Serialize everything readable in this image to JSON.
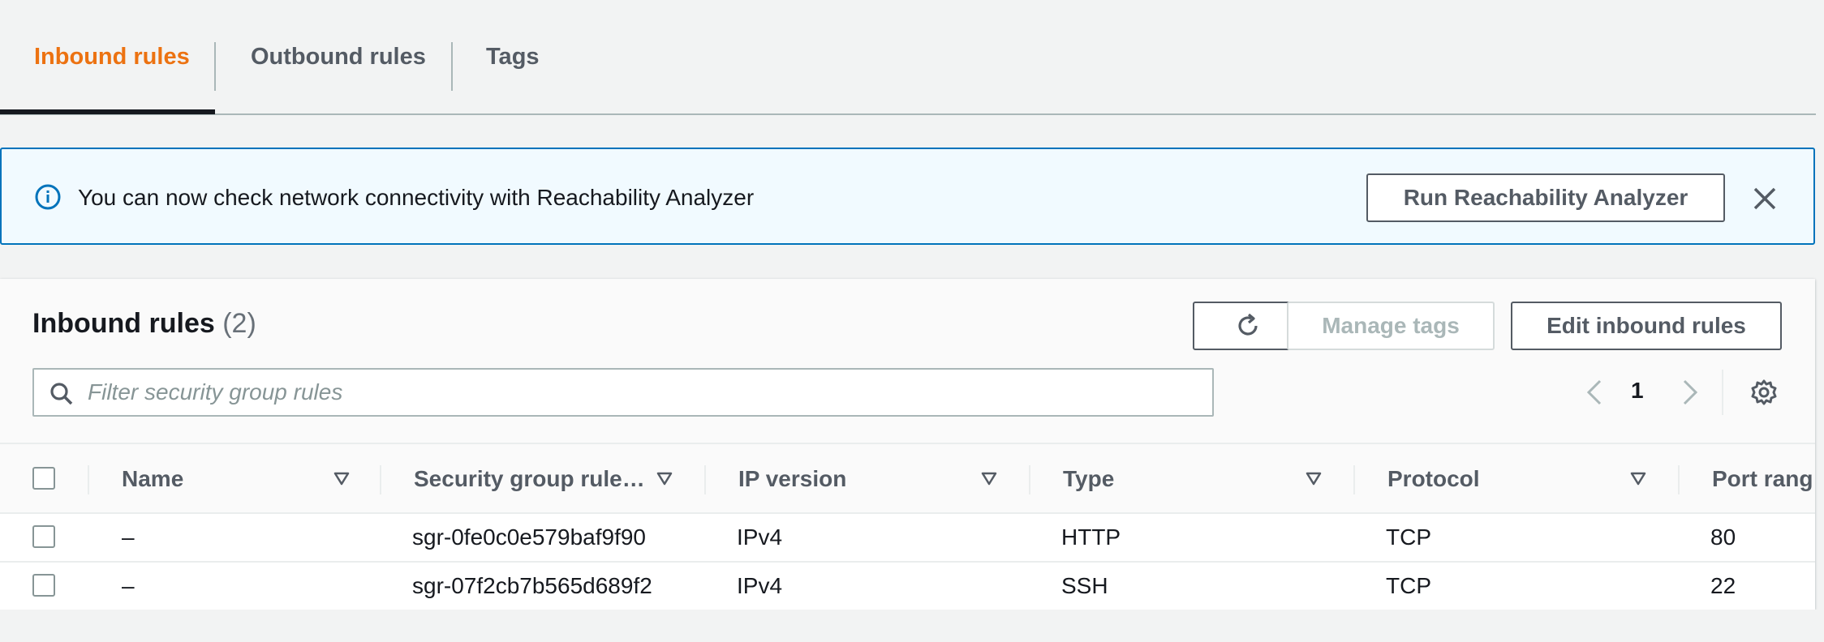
{
  "tabs": [
    {
      "label": "Inbound rules",
      "active": true
    },
    {
      "label": "Outbound rules",
      "active": false
    },
    {
      "label": "Tags",
      "active": false
    }
  ],
  "flash": {
    "text": "You can now check network connectivity with Reachability Analyzer",
    "button_label": "Run Reachability Analyzer",
    "icon": "info-icon",
    "close_icon": "close-icon"
  },
  "panel": {
    "title": "Inbound rules",
    "count": "(2)",
    "manage_tags_label": "Manage tags",
    "edit_label": "Edit inbound rules",
    "refresh_icon": "refresh-icon"
  },
  "search": {
    "placeholder": "Filter security group rules"
  },
  "pagination": {
    "current_page": "1"
  },
  "table": {
    "columns": [
      "Name",
      "Security group rule…",
      "IP version",
      "Type",
      "Protocol",
      "Port rang"
    ],
    "rows": [
      {
        "name": "–",
        "rule_id": "sgr-0fe0c0e579baf9f90",
        "ip_version": "IPv4",
        "type": "HTTP",
        "protocol": "TCP",
        "port": "80"
      },
      {
        "name": "–",
        "rule_id": "sgr-07f2cb7b565d689f2",
        "ip_version": "IPv4",
        "type": "SSH",
        "protocol": "TCP",
        "port": "22"
      }
    ]
  },
  "colors": {
    "accent": "#ec7211",
    "info_blue": "#0073bb",
    "flash_bg": "#f1faff",
    "page_bg": "#f2f3f3"
  }
}
